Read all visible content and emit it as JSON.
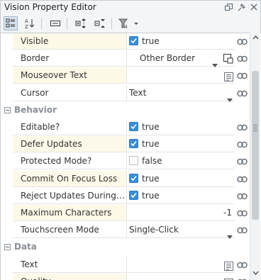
{
  "window": {
    "title": "Vision Property Editor",
    "controls": [
      "restore-icon",
      "pin-icon",
      "close-icon"
    ]
  },
  "toolbar": {
    "buttons": [
      {
        "name": "categorized-view-icon",
        "active": true
      },
      {
        "name": "alphabetical-sort-icon",
        "active": false
      },
      {
        "name": "basic-view-icon",
        "active": false
      },
      {
        "name": "expand-all-icon",
        "active": false
      },
      {
        "name": "collapse-all-icon",
        "active": false
      },
      {
        "name": "filter-icon",
        "active": false
      }
    ]
  },
  "properties": [
    {
      "type": "prop",
      "name": "Visible",
      "kind": "checkbox",
      "checked": true,
      "value": "true",
      "shaded": true
    },
    {
      "type": "prop",
      "name": "Border",
      "kind": "border",
      "value": "Other Border",
      "shaded": false
    },
    {
      "type": "prop",
      "name": "Mouseover Text",
      "kind": "text-editor",
      "value": "",
      "shaded": true
    },
    {
      "type": "prop",
      "name": "Cursor",
      "kind": "dropdown",
      "value": "Text",
      "shaded": false
    },
    {
      "type": "section",
      "name": "Behavior"
    },
    {
      "type": "prop",
      "name": "Editable?",
      "kind": "checkbox",
      "checked": true,
      "value": "true",
      "shaded": false
    },
    {
      "type": "prop",
      "name": "Defer Updates",
      "kind": "checkbox",
      "checked": true,
      "value": "true",
      "shaded": true
    },
    {
      "type": "prop",
      "name": "Protected Mode?",
      "kind": "checkbox",
      "checked": false,
      "value": "false",
      "shaded": false
    },
    {
      "type": "prop",
      "name": "Commit On Focus Loss",
      "kind": "checkbox",
      "checked": true,
      "value": "true",
      "shaded": true
    },
    {
      "type": "prop",
      "name": "Reject Updates During ...",
      "kind": "checkbox",
      "checked": true,
      "value": "true",
      "shaded": false
    },
    {
      "type": "prop",
      "name": "Maximum Characters",
      "kind": "number",
      "value": "-1",
      "shaded": true
    },
    {
      "type": "prop",
      "name": "Touchscreen Mode",
      "kind": "dropdown",
      "value": "Single-Click",
      "shaded": false
    },
    {
      "type": "section",
      "name": "Data"
    },
    {
      "type": "prop",
      "name": "Text",
      "kind": "text-editor",
      "value": "",
      "shaded": false
    },
    {
      "type": "prop",
      "name": "Quality",
      "kind": "text-editor",
      "value": "",
      "shaded": true
    }
  ],
  "colors": {
    "accent": "#3b8ed4",
    "shaded_row": "#fdf9e8",
    "section_text": "#8a8f95"
  }
}
